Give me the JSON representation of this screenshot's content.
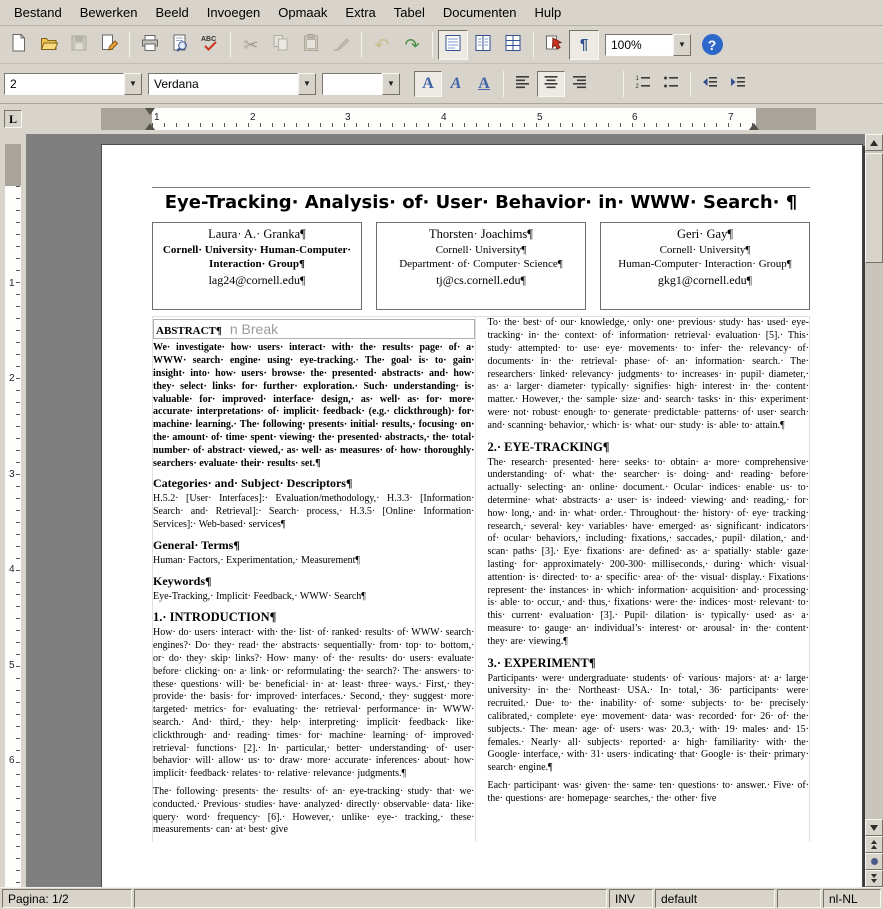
{
  "menu": {
    "items": [
      "Bestand",
      "Bewerken",
      "Beeld",
      "Invoegen",
      "Opmaak",
      "Extra",
      "Tabel",
      "Documenten",
      "Hulp"
    ]
  },
  "toolbar_main": {
    "zoom_value": "100%"
  },
  "toolbar_format": {
    "style_value": "2",
    "font_value": "Verdana",
    "size_value": ""
  },
  "icons": {
    "undo": "↶",
    "redo": "↷",
    "cut": "✂",
    "formatting_marks": "¶",
    "help": "?",
    "dropdown_arrow": "▼",
    "bold": "A",
    "italic": "A",
    "underline": "A",
    "spellcheck_text": "ABC",
    "list_num_1": "1",
    "list_num_2": "2"
  },
  "ruler": {
    "tab_stop_label": "L",
    "h_numbers": [
      "1",
      "2",
      "3",
      "4",
      "5",
      "6",
      "7"
    ],
    "v_numbers": [
      "1",
      "2",
      "3",
      "4",
      "5",
      "6"
    ]
  },
  "document": {
    "title": "Eye-Tracking Analysis of User Behavior in WWW Search ¶",
    "column_break_marker": "n Break",
    "authors": [
      {
        "name": "Laura A. Granka¶",
        "affiliation": [
          "Cornell University Human-Computer Interaction Group¶"
        ],
        "email": "lag24@cornell.edu¶"
      },
      {
        "name": "Thorsten Joachims¶",
        "affiliation": [
          "Cornell University¶",
          "Department of Computer Science¶"
        ],
        "email": "tj@cs.cornell.edu¶"
      },
      {
        "name": "Geri Gay¶",
        "affiliation": [
          "Cornell University¶",
          "Human-Computer Interaction Group¶"
        ],
        "email": "gkg1@cornell.edu¶"
      }
    ],
    "left_column": {
      "abstract_heading": "ABSTRACT¶",
      "abstract_text": "We investigate how users interact with the results page of a WWW search engine using eye-tracking. The goal is to gain insight into how users browse the presented abstracts and how they select links for further exploration. Such understanding is valuable for improved interface design, as well as for more accurate interpretations of implicit feedback (e.g. clickthrough) for machine learning. The following presents initial results, focusing on the amount of time spent viewing the presented abstracts, the total number of abstract viewed, as well as measures of how thoroughly searchers evaluate their results set.¶",
      "categories_heading": "Categories and Subject Descriptors¶",
      "categories_text": "H.5.2 [User Interfaces]: Evaluation/methodology, H.3.3 [Information Search and Retrieval]: Search process, H.3.5 [Online Information Services]: Web-based services¶",
      "general_terms_heading": "General Terms¶",
      "general_terms_text": "Human Factors, Experimentation, Measurement¶",
      "keywords_heading": "Keywords¶",
      "keywords_text": "Eye-Tracking, Implicit Feedback, WWW Search¶",
      "introduction_heading": "1. INTRODUCTION¶",
      "introduction_p1": "How do users interact with the list of ranked results of WWW search engines? Do they read the abstracts sequentially from top to bottom, or do they skip links? How many of the results do users evaluate before clicking on a link or reformulating the search? The answers to these questions will be beneficial in at least three ways. First, they provide the basis for improved interfaces. Second, they suggest more targeted metrics for evaluating the retrieval performance in WWW search. And third, they help interpreting implicit feedback like clickthrough and reading times for machine learning of improved retrieval functions [2]. In particular, better understanding of user behavior will allow us to draw more accurate inferences about how implicit feedback relates to relative relevance judgments.¶",
      "introduction_p2": "The following presents the results of an eye-tracking study that we conducted. Previous studies have analyzed directly observable data like query word frequency [6]. However, unlike eye- tracking, these measurements can at best give"
    },
    "right_column": {
      "related_p": "To the best of our knowledge, only one previous study has used eye-tracking in the context of information retrieval evaluation [5]. This study attempted to use eye movements to infer the relevancy of documents in the retrieval phase of an information search. The researchers linked relevancy judgments to increases in pupil diameter, as a larger diameter typically signifies high interest in the content matter. However, the sample size and search tasks in this experiment were not robust enough to generate predictable patterns of user search and scanning behavior, which is what our study is able to attain.¶",
      "eyetracking_heading": "2. EYE-TRACKING¶",
      "eyetracking_p": "The research presented here seeks to obtain a more comprehensive understanding of what the searcher is doing and reading before actually selecting an online document. Ocular indices enable us to determine what abstracts a user is indeed viewing and reading, for how long, and in what order. Throughout the history of eye tracking research, several key variables have emerged as significant indicators of ocular behaviors, including fixations, saccades, pupil dilation, and scan paths [3]. Eye fixations are defined as a spatially stable gaze lasting for approximately 200-300 milliseconds, during which visual attention is directed to a specific area of the visual display. Fixations represent the instances in which information acquisition and processing is able to occur, and thus, fixations were the indices most relevant to this current evaluation [3]. Pupil dilation is typically used as a measure to gauge an individual’s interest or arousal in the content they are viewing.¶",
      "experiment_heading": "3. EXPERIMENT¶",
      "experiment_p1": "Participants were undergraduate students of various majors at a large university in the Northeast USA. In total, 36 participants were recruited. Due to the inability of some subjects to be precisely calibrated, complete eye movement data was recorded for 26 of the subjects. The mean age of users was 20.3, with 19 males and 15 females. Nearly all subjects reported a high familiarity with the Google interface, with 31 users indicating that Google is their primary search engine.¶",
      "experiment_p2": "Each participant was given the same ten questions to answer. Five of the questions are homepage searches, the other five"
    }
  },
  "statusbar": {
    "page_indicator": "Pagina: 1/2",
    "insert_mode": "INV",
    "page_style": "default",
    "selection_mode": "",
    "language": "nl-NL"
  },
  "colors": {
    "chrome": "#d8d4cb",
    "canvas": "#7f7f7f",
    "accent_blue": "#3f62a8",
    "help_blue": "#2d67c9"
  }
}
